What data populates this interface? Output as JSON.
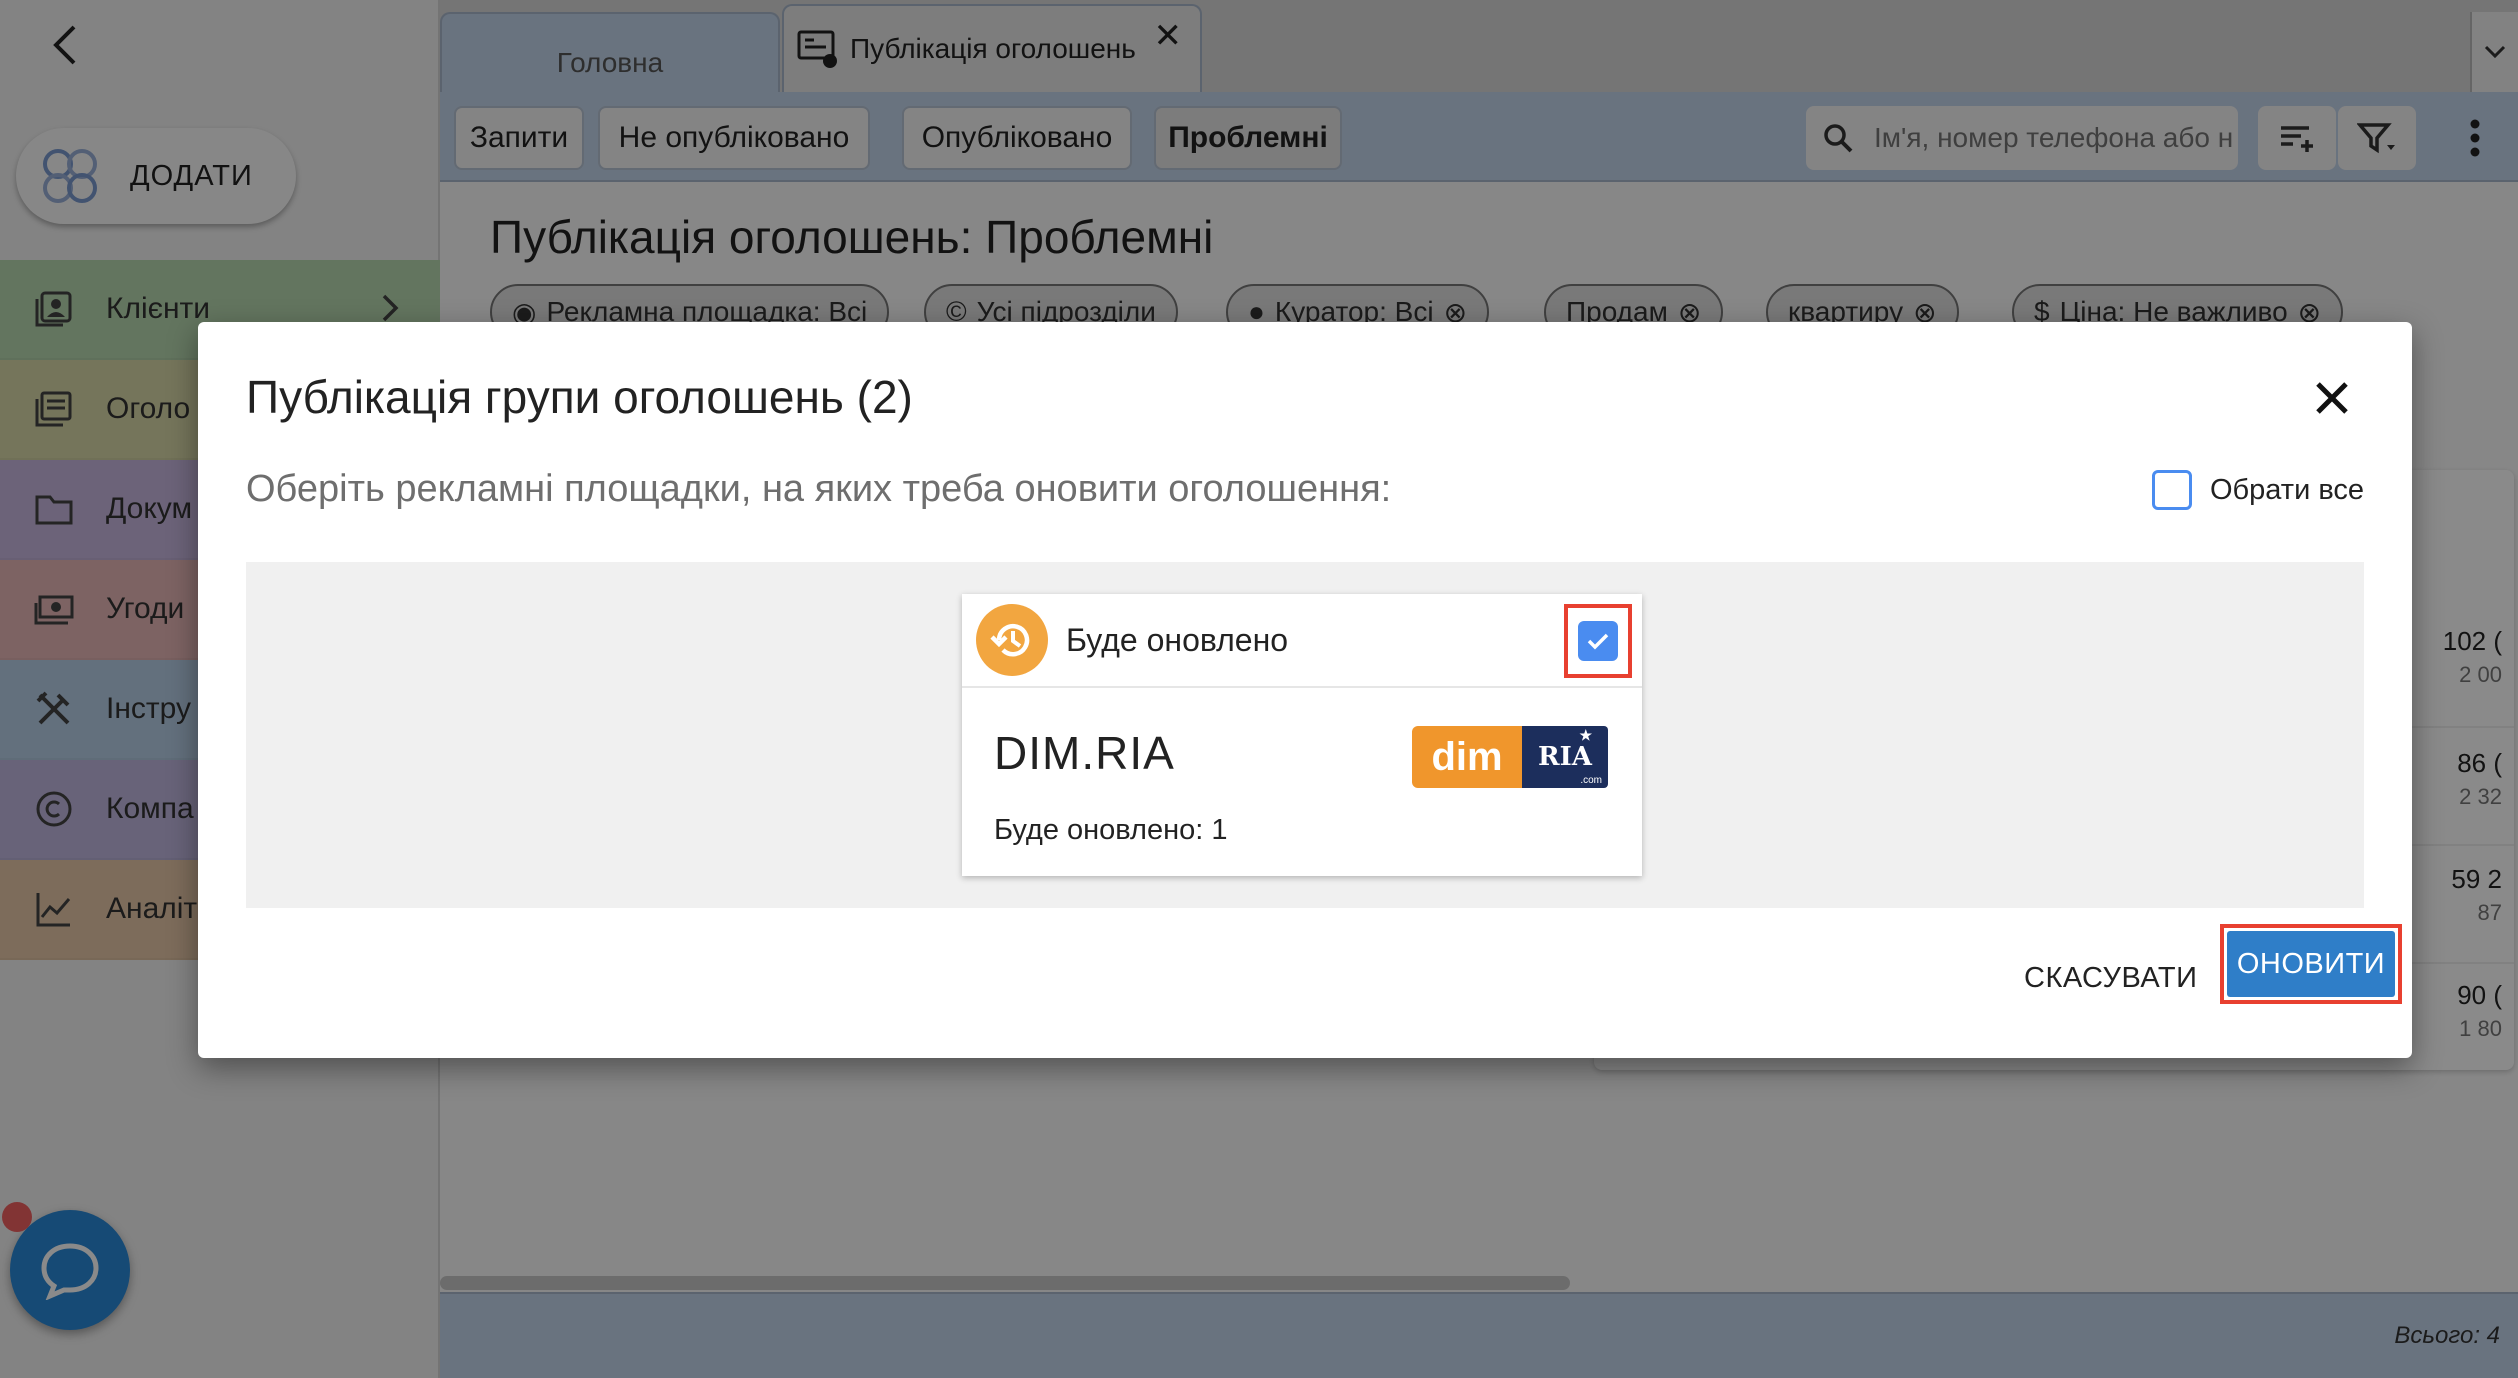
{
  "sidebar": {
    "add_label": "ДОДАТИ",
    "items": [
      {
        "label": "Клієнти",
        "icon": "contacts-icon",
        "color": "#b8d8b0"
      },
      {
        "label": "Оголо",
        "icon": "listing-icon",
        "color": "#d8d8a8"
      },
      {
        "label": "Докум",
        "icon": "folder-icon",
        "color": "#c8b8e0"
      },
      {
        "label": "Угоди",
        "icon": "money-icon",
        "color": "#e8b8b8"
      },
      {
        "label": "Інстру",
        "icon": "tools-icon",
        "color": "#b8d0e8"
      },
      {
        "label": "Компа",
        "icon": "copyright-icon",
        "color": "#c0b8e0"
      },
      {
        "label": "Аналіт",
        "icon": "analytics-icon",
        "color": "#e8c8a8"
      }
    ]
  },
  "tabs": {
    "home": "Головна",
    "active": "Публікація оголошень"
  },
  "toolbar": {
    "buttons": [
      "Запити",
      "Не опубліковано",
      "Опубліковано",
      "Проблемні"
    ],
    "search_placeholder": "Ім'я, номер телефона або н"
  },
  "page": {
    "title": "Публікація оголошень: Проблемні",
    "filters": [
      "Рекламна площадка: Всі",
      "Усі підрозділи",
      "Куратор: Всі",
      "Продам",
      "квартиру",
      "Ціна: Не важливо"
    ]
  },
  "table": {
    "rows": [
      {
        "value": "102 (",
        "sub": "2 00"
      },
      {
        "value": "86 (",
        "sub": "2 32"
      },
      {
        "value": "59 2",
        "sub": "87"
      },
      {
        "value": "90 (",
        "sub": "1 80"
      }
    ]
  },
  "footer": {
    "total": "Всього: 4"
  },
  "dialog": {
    "title": "Публікація групи оголошень (2)",
    "subtitle": "Оберіть рекламні площадки, на яких треба оновити оголошення:",
    "select_all": "Обрати все",
    "platform": {
      "status": "Буде оновлено",
      "name": "DIM.RIA",
      "count_text": "Буде оновлено: 1",
      "logo_left": "dim",
      "logo_right": "RIA",
      "logo_sub": ".com",
      "checked": true
    },
    "cancel": "СКАСУВАТИ",
    "update": "ОНОВИТИ"
  },
  "colors": {
    "accent": "#2f7ec8",
    "checkbox": "#4a8cf0",
    "highlight": "#e84030",
    "status": "#f2a640",
    "toolbar": "#c3d4ea"
  }
}
